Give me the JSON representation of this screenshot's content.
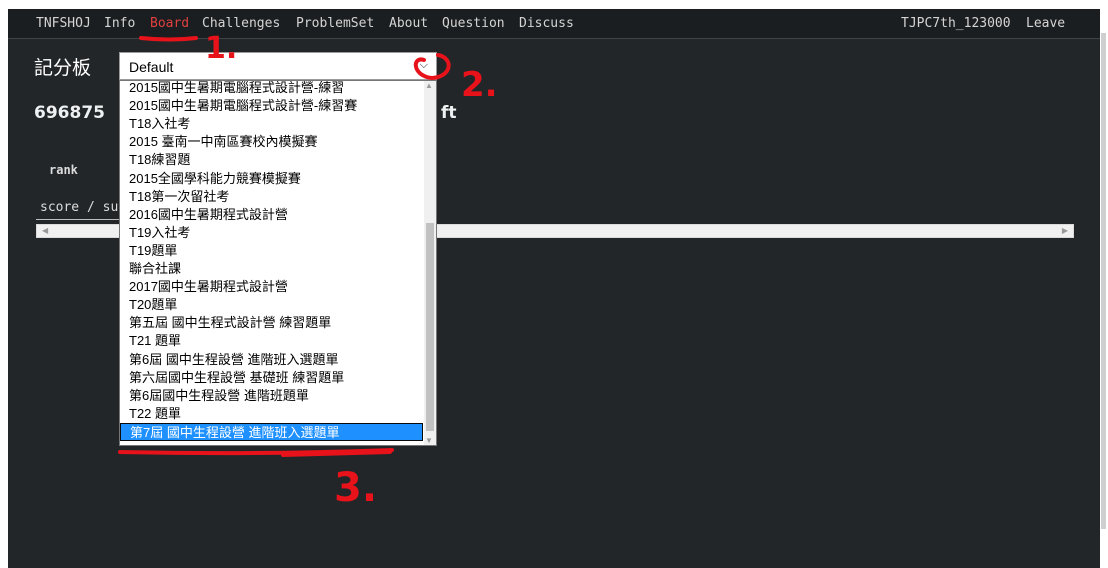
{
  "nav": {
    "items": [
      "TNFSHOJ",
      "Info",
      "Board",
      "Challenges",
      "ProblemSet",
      "About",
      "Question",
      "Discuss"
    ],
    "active": "Board",
    "user": "TJPC7th_123000",
    "leave": "Leave"
  },
  "page": {
    "title": "記分板",
    "board_name_visible_start": "696875",
    "board_name_visible_end": "ft"
  },
  "select": {
    "value": "Default"
  },
  "table": {
    "rank_header": "rank",
    "score_header": "score / su"
  },
  "dropdown": {
    "options": [
      "2015國中生暑期電腦程式設計營-練習",
      "2015國中生暑期電腦程式設計營-練習賽",
      "T18入社考",
      "2015 臺南一中南區賽校內模擬賽",
      "T18練習題",
      "2015全國學科能力競賽模擬賽",
      "T18第一次留社考",
      "2016國中生暑期程式設計營",
      "T19入社考",
      "T19題單",
      "聯合社課",
      "2017國中生暑期程式設計營",
      "T20題單",
      "第五屆 國中生程式設計營 練習題單",
      "T21 題單",
      "第6屆 國中生程設營 進階班入選題單",
      "第六屆國中生程設營 基礎班 練習題單",
      "第6屆國中生程設營 進階班題單",
      "T22 題單",
      "第7屆 國中生程設營 進階班入選題單"
    ],
    "selected_index": 19
  },
  "annotations": {
    "step1": "1.",
    "step2": "2.",
    "step3": "3.",
    "color": "#e8121b"
  }
}
